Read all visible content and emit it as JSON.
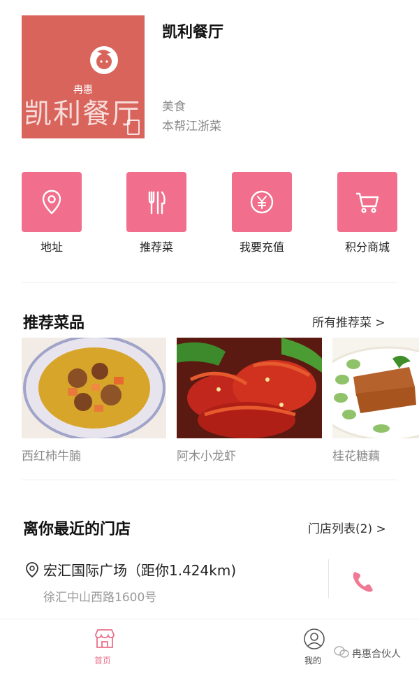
{
  "header": {
    "brand_text": "冉惠",
    "logo_name": "凯利餐厅",
    "name": "凯利餐厅",
    "category": "美食",
    "cuisine": "本帮江浙菜"
  },
  "actions": [
    {
      "label": "地址",
      "icon": "location-pin-icon"
    },
    {
      "label": "推荐菜",
      "icon": "fork-knife-icon"
    },
    {
      "label": "我要充值",
      "icon": "yen-coin-icon"
    },
    {
      "label": "积分商城",
      "icon": "shopping-cart-icon"
    }
  ],
  "recommended": {
    "title": "推荐菜品",
    "link": "所有推荐菜 >",
    "dishes": [
      {
        "name": "西红柿牛腩"
      },
      {
        "name": "阿木小龙虾"
      },
      {
        "name": "桂花糖藕"
      }
    ]
  },
  "nearest": {
    "title": "离你最近的门店",
    "link": "门店列表(2) >",
    "store_name": "宏汇国际广场（距你1.424km)",
    "address": "徐汇中山西路1600号"
  },
  "nav": {
    "home": "首页",
    "mine": "我的"
  },
  "watermark": "冉惠合伙人",
  "colors": {
    "accent": "#f16f8c",
    "logo_bg": "#d8645b",
    "nav_active": "#e8708a"
  }
}
